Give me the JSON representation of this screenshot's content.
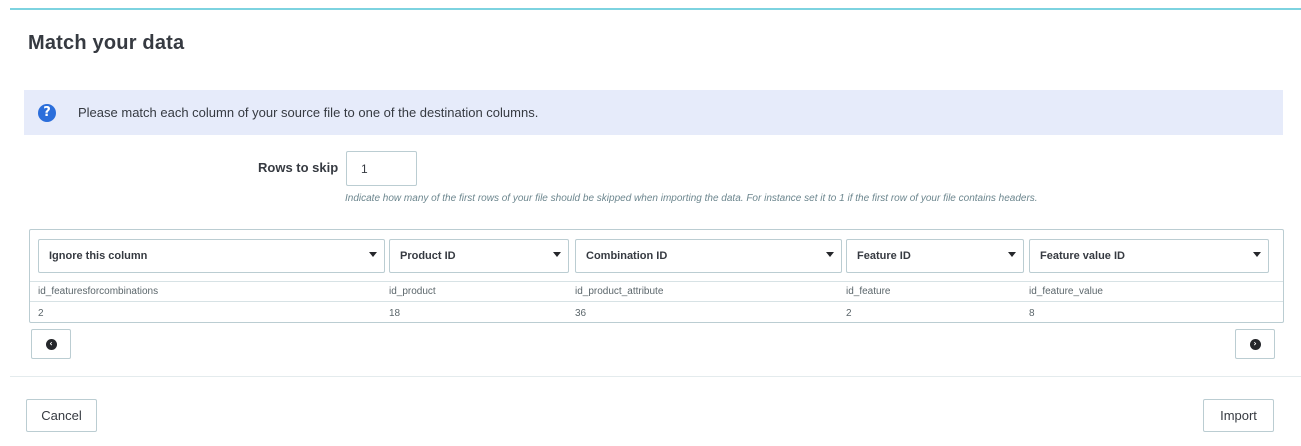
{
  "panel": {
    "title": "Match your data"
  },
  "info": {
    "icon": "question-circle-icon",
    "text": "Please match each column of your source file to one of the destination columns."
  },
  "rows_to_skip": {
    "label": "Rows to skip",
    "value": "1",
    "help": "Indicate how many of the first rows of your file should be skipped when importing the data. For instance set it to 1 if the first row of your file contains headers."
  },
  "columns": [
    {
      "select": "Ignore this column",
      "header": "id_featuresforcombinations",
      "value": "2"
    },
    {
      "select": "Product ID",
      "header": "id_product",
      "value": "18"
    },
    {
      "select": "Combination ID",
      "header": "id_product_attribute",
      "value": "36"
    },
    {
      "select": "Feature ID",
      "header": "id_feature",
      "value": "2"
    },
    {
      "select": "Feature value ID",
      "header": "id_feature_value",
      "value": "8"
    }
  ],
  "nav": {
    "prev_icon": "chevron-circle-left-icon",
    "next_icon": "chevron-circle-right-icon"
  },
  "footer": {
    "cancel_label": "Cancel",
    "import_label": "Import"
  }
}
